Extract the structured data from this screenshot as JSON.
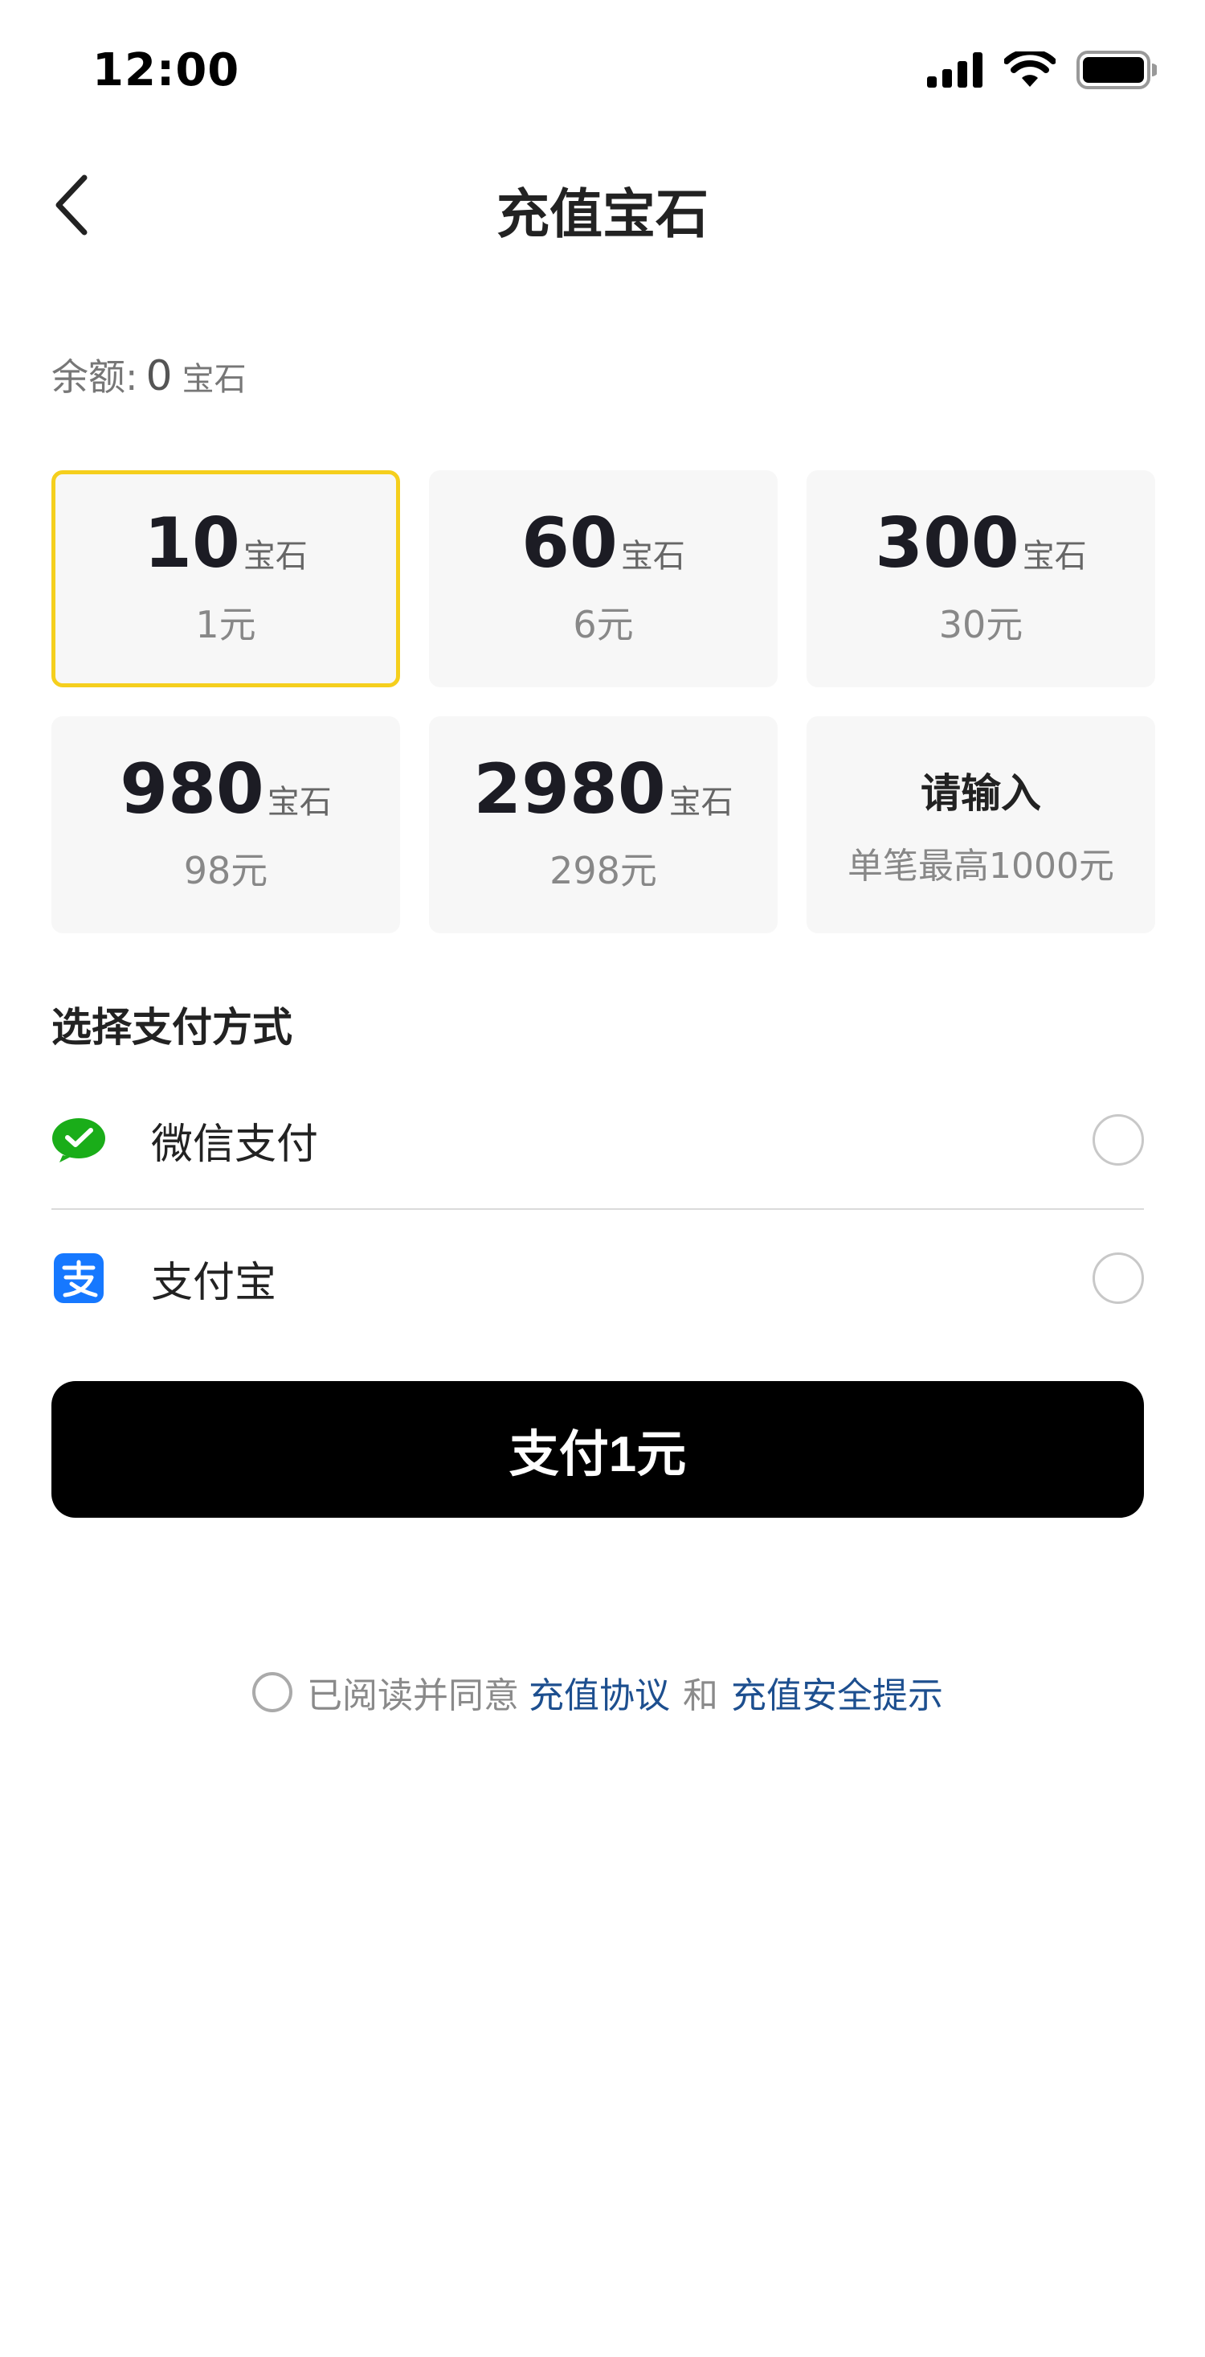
{
  "status_bar": {
    "time": "12:00"
  },
  "header": {
    "title": "充值宝石"
  },
  "balance": {
    "label": "余额:",
    "value": "0",
    "unit": "宝石"
  },
  "packages": [
    {
      "gems": "10",
      "unit": "宝石",
      "price": "1元",
      "selected": true
    },
    {
      "gems": "60",
      "unit": "宝石",
      "price": "6元",
      "selected": false
    },
    {
      "gems": "300",
      "unit": "宝石",
      "price": "30元",
      "selected": false
    },
    {
      "gems": "980",
      "unit": "宝石",
      "price": "98元",
      "selected": false
    },
    {
      "gems": "2980",
      "unit": "宝石",
      "price": "298元",
      "selected": false
    }
  ],
  "custom_package": {
    "label": "请输入",
    "sub": "单笔最高1000元"
  },
  "payment": {
    "heading": "选择支付方式",
    "methods": [
      {
        "label": "微信支付",
        "icon": "wechat-pay-icon",
        "color": "#1aad19"
      },
      {
        "label": "支付宝",
        "icon": "alipay-icon",
        "color": "#1678ff"
      }
    ]
  },
  "pay_button": {
    "label": "支付1元"
  },
  "agreement": {
    "prefix": "已阅读并同意",
    "link1": "充值协议",
    "conj": "和",
    "link2": "充值安全提示"
  },
  "colors": {
    "selected_border": "#f5cf1d",
    "link": "#1d4f8f",
    "button": "#000000"
  }
}
